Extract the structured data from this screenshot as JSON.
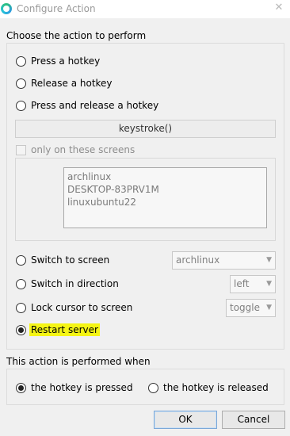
{
  "window": {
    "title": "Configure Action",
    "close_glyph": "✕",
    "app_icon": "app-ring-icon"
  },
  "action_section": {
    "label": "Choose the action to perform",
    "options": [
      {
        "label": "Press a hotkey",
        "checked": false
      },
      {
        "label": "Release a hotkey",
        "checked": false
      },
      {
        "label": "Press and release a hotkey",
        "checked": false
      }
    ],
    "keystroke_button": "keystroke()",
    "only_on_screens_label": "only on these screens",
    "screens": [
      "archlinux",
      "DESKTOP-83PRV1M",
      "linuxubuntu22"
    ],
    "switch_to_screen": {
      "label": "Switch to screen",
      "value": "archlinux"
    },
    "switch_direction": {
      "label": "Switch in direction",
      "value": "left"
    },
    "lock_cursor": {
      "label": "Lock cursor to screen",
      "value": "toggle"
    },
    "restart_server": {
      "label": "Restart server",
      "checked": true,
      "highlight_color": "#f5f514"
    }
  },
  "when_section": {
    "label": "This action is performed when",
    "pressed_label": "the hotkey is pressed",
    "released_label": "the hotkey is released",
    "selected": "pressed"
  },
  "buttons": {
    "ok": "OK",
    "cancel": "Cancel"
  },
  "icons": {
    "dropdown_arrow": "▼"
  }
}
